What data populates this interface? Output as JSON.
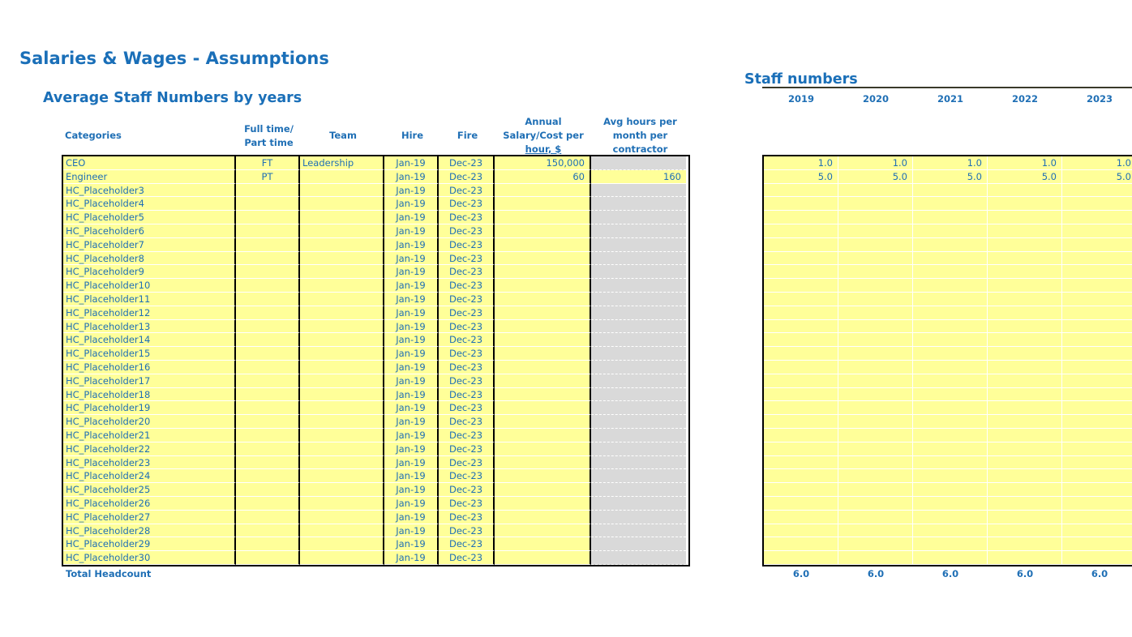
{
  "page": {
    "title": "Salaries & Wages - Assumptions",
    "subtitle": "Average Staff Numbers by years",
    "staff_title": "Staff numbers"
  },
  "headers": {
    "categories": "Categories",
    "ft_pt_line1": "Full time/",
    "ft_pt_line2": "Part time",
    "team": "Team",
    "hire": "Hire",
    "fire": "Fire",
    "salary_line1": "Annual",
    "salary_line2": "Salary/Cost per",
    "salary_line3": "hour, $",
    "hours_line1": "Avg hours per",
    "hours_line2": "month per",
    "hours_line3": "contractor"
  },
  "years": [
    "2019",
    "2020",
    "2021",
    "2022",
    "2023"
  ],
  "rows": [
    {
      "category": "CEO",
      "ftpt": "FT",
      "team": "Leadership",
      "hire": "Jan-19",
      "fire": "Dec-23",
      "salary": "150,000",
      "hours": "",
      "hours_grey": true,
      "staff": [
        "1.0",
        "1.0",
        "1.0",
        "1.0",
        "1.0"
      ]
    },
    {
      "category": "Engineer",
      "ftpt": "PT",
      "team": "",
      "hire": "Jan-19",
      "fire": "Dec-23",
      "salary": "60",
      "hours": "160",
      "hours_grey": false,
      "staff": [
        "5.0",
        "5.0",
        "5.0",
        "5.0",
        "5.0"
      ]
    },
    {
      "category": "HC_Placeholder3",
      "ftpt": "",
      "team": "",
      "hire": "Jan-19",
      "fire": "Dec-23",
      "salary": "",
      "hours": "",
      "hours_grey": true,
      "staff": [
        "",
        "",
        "",
        "",
        ""
      ]
    },
    {
      "category": "HC_Placeholder4",
      "ftpt": "",
      "team": "",
      "hire": "Jan-19",
      "fire": "Dec-23",
      "salary": "",
      "hours": "",
      "hours_grey": true,
      "staff": [
        "",
        "",
        "",
        "",
        ""
      ]
    },
    {
      "category": "HC_Placeholder5",
      "ftpt": "",
      "team": "",
      "hire": "Jan-19",
      "fire": "Dec-23",
      "salary": "",
      "hours": "",
      "hours_grey": true,
      "staff": [
        "",
        "",
        "",
        "",
        ""
      ]
    },
    {
      "category": "HC_Placeholder6",
      "ftpt": "",
      "team": "",
      "hire": "Jan-19",
      "fire": "Dec-23",
      "salary": "",
      "hours": "",
      "hours_grey": true,
      "staff": [
        "",
        "",
        "",
        "",
        ""
      ]
    },
    {
      "category": "HC_Placeholder7",
      "ftpt": "",
      "team": "",
      "hire": "Jan-19",
      "fire": "Dec-23",
      "salary": "",
      "hours": "",
      "hours_grey": true,
      "staff": [
        "",
        "",
        "",
        "",
        ""
      ]
    },
    {
      "category": "HC_Placeholder8",
      "ftpt": "",
      "team": "",
      "hire": "Jan-19",
      "fire": "Dec-23",
      "salary": "",
      "hours": "",
      "hours_grey": true,
      "staff": [
        "",
        "",
        "",
        "",
        ""
      ]
    },
    {
      "category": "HC_Placeholder9",
      "ftpt": "",
      "team": "",
      "hire": "Jan-19",
      "fire": "Dec-23",
      "salary": "",
      "hours": "",
      "hours_grey": true,
      "staff": [
        "",
        "",
        "",
        "",
        ""
      ]
    },
    {
      "category": "HC_Placeholder10",
      "ftpt": "",
      "team": "",
      "hire": "Jan-19",
      "fire": "Dec-23",
      "salary": "",
      "hours": "",
      "hours_grey": true,
      "staff": [
        "",
        "",
        "",
        "",
        ""
      ]
    },
    {
      "category": "HC_Placeholder11",
      "ftpt": "",
      "team": "",
      "hire": "Jan-19",
      "fire": "Dec-23",
      "salary": "",
      "hours": "",
      "hours_grey": true,
      "staff": [
        "",
        "",
        "",
        "",
        ""
      ]
    },
    {
      "category": "HC_Placeholder12",
      "ftpt": "",
      "team": "",
      "hire": "Jan-19",
      "fire": "Dec-23",
      "salary": "",
      "hours": "",
      "hours_grey": true,
      "staff": [
        "",
        "",
        "",
        "",
        ""
      ]
    },
    {
      "category": "HC_Placeholder13",
      "ftpt": "",
      "team": "",
      "hire": "Jan-19",
      "fire": "Dec-23",
      "salary": "",
      "hours": "",
      "hours_grey": true,
      "staff": [
        "",
        "",
        "",
        "",
        ""
      ]
    },
    {
      "category": "HC_Placeholder14",
      "ftpt": "",
      "team": "",
      "hire": "Jan-19",
      "fire": "Dec-23",
      "salary": "",
      "hours": "",
      "hours_grey": true,
      "staff": [
        "",
        "",
        "",
        "",
        ""
      ]
    },
    {
      "category": "HC_Placeholder15",
      "ftpt": "",
      "team": "",
      "hire": "Jan-19",
      "fire": "Dec-23",
      "salary": "",
      "hours": "",
      "hours_grey": true,
      "staff": [
        "",
        "",
        "",
        "",
        ""
      ]
    },
    {
      "category": "HC_Placeholder16",
      "ftpt": "",
      "team": "",
      "hire": "Jan-19",
      "fire": "Dec-23",
      "salary": "",
      "hours": "",
      "hours_grey": true,
      "staff": [
        "",
        "",
        "",
        "",
        ""
      ]
    },
    {
      "category": "HC_Placeholder17",
      "ftpt": "",
      "team": "",
      "hire": "Jan-19",
      "fire": "Dec-23",
      "salary": "",
      "hours": "",
      "hours_grey": true,
      "staff": [
        "",
        "",
        "",
        "",
        ""
      ]
    },
    {
      "category": "HC_Placeholder18",
      "ftpt": "",
      "team": "",
      "hire": "Jan-19",
      "fire": "Dec-23",
      "salary": "",
      "hours": "",
      "hours_grey": true,
      "staff": [
        "",
        "",
        "",
        "",
        ""
      ]
    },
    {
      "category": "HC_Placeholder19",
      "ftpt": "",
      "team": "",
      "hire": "Jan-19",
      "fire": "Dec-23",
      "salary": "",
      "hours": "",
      "hours_grey": true,
      "staff": [
        "",
        "",
        "",
        "",
        ""
      ]
    },
    {
      "category": "HC_Placeholder20",
      "ftpt": "",
      "team": "",
      "hire": "Jan-19",
      "fire": "Dec-23",
      "salary": "",
      "hours": "",
      "hours_grey": true,
      "staff": [
        "",
        "",
        "",
        "",
        ""
      ]
    },
    {
      "category": "HC_Placeholder21",
      "ftpt": "",
      "team": "",
      "hire": "Jan-19",
      "fire": "Dec-23",
      "salary": "",
      "hours": "",
      "hours_grey": true,
      "staff": [
        "",
        "",
        "",
        "",
        ""
      ]
    },
    {
      "category": "HC_Placeholder22",
      "ftpt": "",
      "team": "",
      "hire": "Jan-19",
      "fire": "Dec-23",
      "salary": "",
      "hours": "",
      "hours_grey": true,
      "staff": [
        "",
        "",
        "",
        "",
        ""
      ]
    },
    {
      "category": "HC_Placeholder23",
      "ftpt": "",
      "team": "",
      "hire": "Jan-19",
      "fire": "Dec-23",
      "salary": "",
      "hours": "",
      "hours_grey": true,
      "staff": [
        "",
        "",
        "",
        "",
        ""
      ]
    },
    {
      "category": "HC_Placeholder24",
      "ftpt": "",
      "team": "",
      "hire": "Jan-19",
      "fire": "Dec-23",
      "salary": "",
      "hours": "",
      "hours_grey": true,
      "staff": [
        "",
        "",
        "",
        "",
        ""
      ]
    },
    {
      "category": "HC_Placeholder25",
      "ftpt": "",
      "team": "",
      "hire": "Jan-19",
      "fire": "Dec-23",
      "salary": "",
      "hours": "",
      "hours_grey": true,
      "staff": [
        "",
        "",
        "",
        "",
        ""
      ]
    },
    {
      "category": "HC_Placeholder26",
      "ftpt": "",
      "team": "",
      "hire": "Jan-19",
      "fire": "Dec-23",
      "salary": "",
      "hours": "",
      "hours_grey": true,
      "staff": [
        "",
        "",
        "",
        "",
        ""
      ]
    },
    {
      "category": "HC_Placeholder27",
      "ftpt": "",
      "team": "",
      "hire": "Jan-19",
      "fire": "Dec-23",
      "salary": "",
      "hours": "",
      "hours_grey": true,
      "staff": [
        "",
        "",
        "",
        "",
        ""
      ]
    },
    {
      "category": "HC_Placeholder28",
      "ftpt": "",
      "team": "",
      "hire": "Jan-19",
      "fire": "Dec-23",
      "salary": "",
      "hours": "",
      "hours_grey": true,
      "staff": [
        "",
        "",
        "",
        "",
        ""
      ]
    },
    {
      "category": "HC_Placeholder29",
      "ftpt": "",
      "team": "",
      "hire": "Jan-19",
      "fire": "Dec-23",
      "salary": "",
      "hours": "",
      "hours_grey": true,
      "staff": [
        "",
        "",
        "",
        "",
        ""
      ]
    },
    {
      "category": "HC_Placeholder30",
      "ftpt": "",
      "team": "",
      "hire": "Jan-19",
      "fire": "Dec-23",
      "salary": "",
      "hours": "",
      "hours_grey": true,
      "staff": [
        "",
        "",
        "",
        "",
        ""
      ]
    }
  ],
  "totals": {
    "label": "Total Headcount",
    "values": [
      "6.0",
      "6.0",
      "6.0",
      "6.0",
      "6.0"
    ]
  },
  "colors": {
    "heading_blue": "#1a6fb8",
    "input_yellow": "#ffff99",
    "disabled_grey": "#d9d9d9"
  }
}
